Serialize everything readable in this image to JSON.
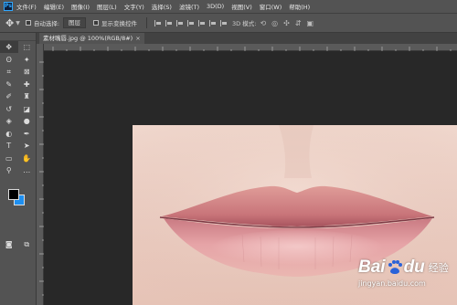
{
  "app": {
    "logo_text": "Ps"
  },
  "menubar": {
    "items": [
      "文件(F)",
      "编辑(E)",
      "图像(I)",
      "图层(L)",
      "文字(Y)",
      "选择(S)",
      "滤镜(T)",
      "3D(D)",
      "视图(V)",
      "窗口(W)",
      "帮助(H)"
    ]
  },
  "options": {
    "auto_select_label": "自动选择:",
    "auto_select_value": "图层",
    "show_transform_label": "显示变换控件",
    "mode_label": "3D 模式:"
  },
  "document": {
    "tab_title": "素材嘴唇.jpg @ 100%(RGB/8#)",
    "close_glyph": "×"
  },
  "colors": {
    "foreground": "#000000",
    "background": "#1e8ff0",
    "ui_dark": "#282828",
    "ui_panel": "#535353"
  },
  "tools": [
    [
      "move-icon",
      "marquee-icon"
    ],
    [
      "lasso-icon",
      "magic-wand-icon"
    ],
    [
      "crop-icon",
      "frame-icon"
    ],
    [
      "eyedropper-icon",
      "healing-icon"
    ],
    [
      "brush-icon",
      "stamp-icon"
    ],
    [
      "history-brush-icon",
      "eraser-icon"
    ],
    [
      "bucket-icon",
      "blur-icon"
    ],
    [
      "dodge-icon",
      "pen-icon"
    ],
    [
      "type-icon",
      "path-select-icon"
    ],
    [
      "rectangle-icon",
      "hand-icon"
    ],
    [
      "zoom-icon",
      "more-icon"
    ]
  ],
  "watermark": {
    "brand_left": "Bai",
    "brand_right": "du",
    "brand_cn": "经验",
    "url": "jingyan.baidu.com"
  }
}
